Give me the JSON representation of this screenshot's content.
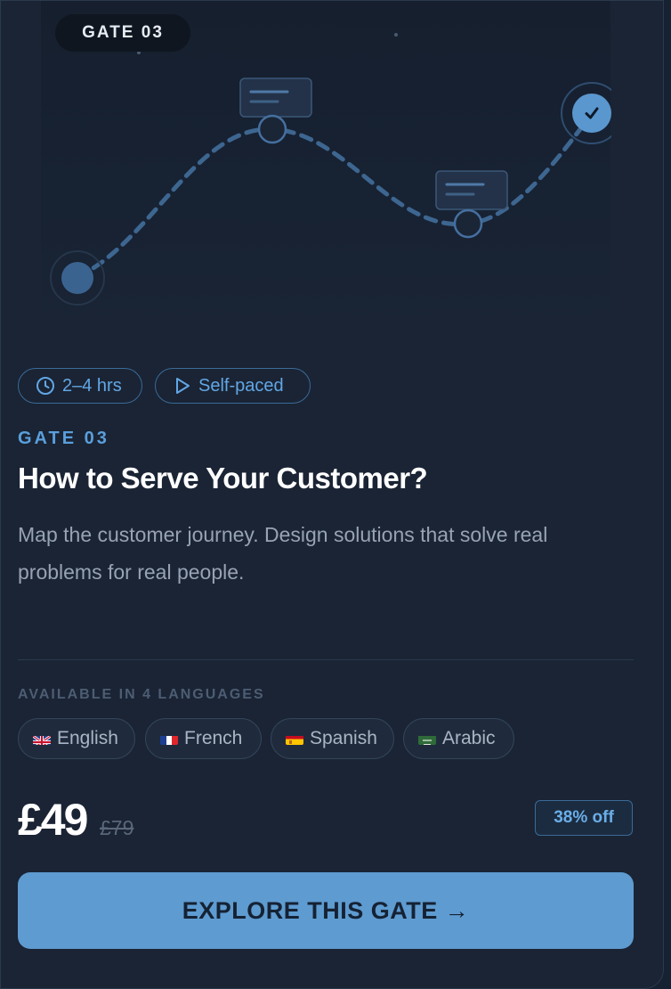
{
  "hero": {
    "badge": "GATE 03",
    "check_glyph": "✓"
  },
  "meta": {
    "duration": "2–4 hrs",
    "duration_icon": "clock-icon",
    "pace": "Self-paced",
    "pace_icon": "play-icon"
  },
  "gate": {
    "eyebrow": "GATE 03",
    "title": "How to Serve Your Customer?",
    "description": "Map the customer journey. Design solutions that solve real problems for real people."
  },
  "languages": {
    "label": "AVAILABLE IN 4 LANGUAGES",
    "items": [
      {
        "name": "English",
        "flag": "uk-flag-icon"
      },
      {
        "name": "French",
        "flag": "france-flag-icon"
      },
      {
        "name": "Spanish",
        "flag": "spain-flag-icon"
      },
      {
        "name": "Arabic",
        "flag": "saudi-flag-icon"
      }
    ]
  },
  "pricing": {
    "price": "£49",
    "old_price": "£79",
    "discount": "38% off"
  },
  "cta": {
    "label": "EXPLORE THIS GATE →"
  },
  "colors": {
    "card_bg": "#1a2434",
    "accent": "#5e9bd0",
    "chip_text": "#62a7e6",
    "title": "#ffffff",
    "muted": "#97a3b4"
  }
}
